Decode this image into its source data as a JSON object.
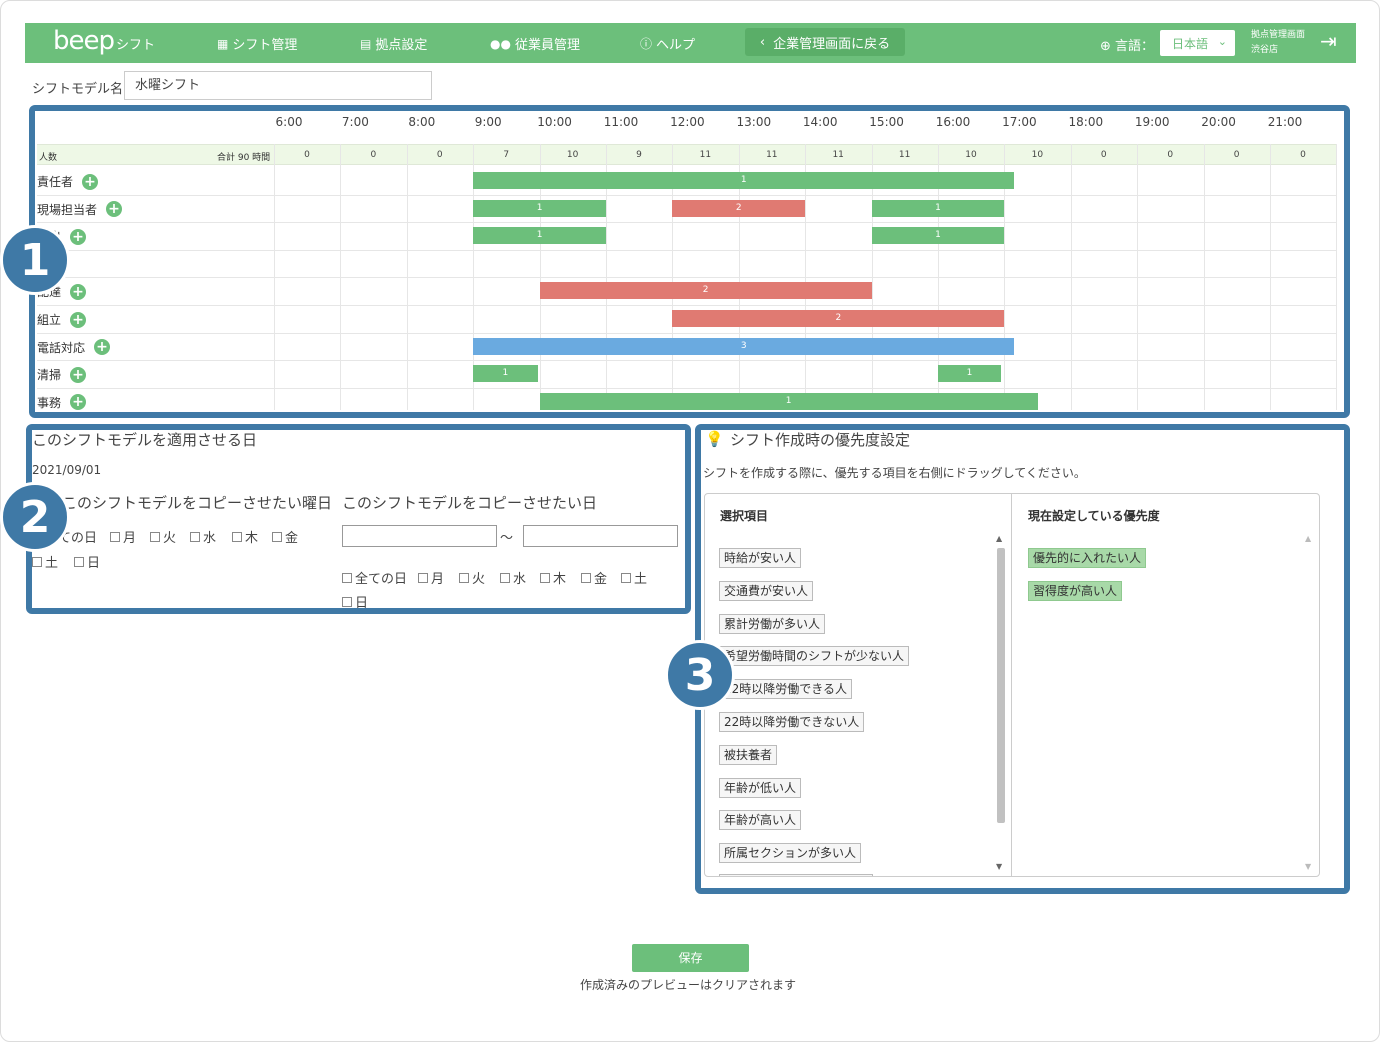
{
  "header": {
    "logo": "beep",
    "logo_sub": "シフト",
    "nav": [
      {
        "icon": "calendar-icon",
        "label": "シフト管理"
      },
      {
        "icon": "building-icon",
        "label": "拠点設定"
      },
      {
        "icon": "users-icon",
        "label": "従業員管理"
      },
      {
        "icon": "info-icon",
        "label": "ヘルプ"
      }
    ],
    "back_button": "企業管理画面に戻る",
    "language_label": "言語：",
    "language_value": "日本語",
    "store_line1": "拠点管理画面",
    "store_line2": "渋谷店"
  },
  "model": {
    "label": "シフトモデル名",
    "value": "水曜シフト"
  },
  "timeline": {
    "hours": [
      "6:00",
      "7:00",
      "8:00",
      "9:00",
      "10:00",
      "11:00",
      "12:00",
      "13:00",
      "14:00",
      "15:00",
      "16:00",
      "17:00",
      "18:00",
      "19:00",
      "20:00",
      "21:00"
    ],
    "count_label": "人数",
    "total_label": "合計 90 時間",
    "counts": [
      "0",
      "0",
      "0",
      "7",
      "10",
      "9",
      "11",
      "11",
      "11",
      "11",
      "10",
      "10",
      "0",
      "0",
      "0",
      "0"
    ],
    "rows": [
      {
        "label": "責任者",
        "bars": [
          {
            "start": 9,
            "end": 17.15,
            "count": "1",
            "color": "#6cbf7b"
          }
        ]
      },
      {
        "label": "現場担当者",
        "bars": [
          {
            "start": 9,
            "end": 11,
            "count": "1",
            "color": "#6cbf7b"
          },
          {
            "start": 12,
            "end": 14,
            "count": "2",
            "color": "#e07a72"
          },
          {
            "start": 15,
            "end": 17,
            "count": "1",
            "color": "#6cbf7b"
          }
        ]
      },
      {
        "label": "品出",
        "bars": [
          {
            "start": 9,
            "end": 11,
            "count": "1",
            "color": "#6cbf7b"
          },
          {
            "start": 15,
            "end": 17,
            "count": "1",
            "color": "#6cbf7b"
          }
        ]
      },
      {
        "label": "",
        "bars": []
      },
      {
        "label": "配達",
        "bars": [
          {
            "start": 10,
            "end": 15,
            "count": "2",
            "color": "#e07a72"
          }
        ]
      },
      {
        "label": "組立",
        "bars": [
          {
            "start": 12,
            "end": 17,
            "count": "2",
            "color": "#e07a72"
          }
        ]
      },
      {
        "label": "電話対応",
        "bars": [
          {
            "start": 9,
            "end": 17.15,
            "count": "3",
            "color": "#6aaae0"
          }
        ]
      },
      {
        "label": "清掃",
        "bars": [
          {
            "start": 9,
            "end": 9.97,
            "count": "1",
            "color": "#6cbf7b"
          },
          {
            "start": 16,
            "end": 16.95,
            "count": "1",
            "color": "#6cbf7b"
          }
        ]
      },
      {
        "label": "事務",
        "bars": [
          {
            "start": 10,
            "end": 17.5,
            "count": "1",
            "color": "#6cbf7b"
          }
        ]
      }
    ]
  },
  "apply": {
    "title": "このシフトモデルを適用させる日",
    "date": "2021/09/01",
    "weekday_title": "このシフトモデルをコピーさせたい曜日",
    "date_title": "このシフトモデルをコピーさせたい日",
    "weekdays": [
      "全ての日",
      "月",
      "火",
      "水",
      "木",
      "金",
      "土",
      "日"
    ],
    "range_sep": "～"
  },
  "priority": {
    "title": "シフト作成時の優先度設定",
    "description": "シフトを作成する際に、優先する項目を右側にドラッグしてください。",
    "left_header": "選択項目",
    "right_header": "現在設定している優先度",
    "options": [
      "時給が安い人",
      "交通費が安い人",
      "累計労働が多い人",
      "希望労働時間のシフトが少ない人",
      "22時以降労働できる人",
      "22時以降労働できない人",
      "被扶養者",
      "年齢が低い人",
      "年齢が高い人",
      "所属セクションが多い人"
    ],
    "selected": [
      "優先的に入れたい人",
      "習得度が高い人"
    ]
  },
  "badges": [
    "1",
    "2",
    "3"
  ],
  "footer": {
    "save": "保存",
    "note": "作成済みのプレビューはクリアされます"
  },
  "colors": {
    "brand": "#6cbf7b",
    "highlight": "#3f79a6",
    "bar_red": "#e07a72",
    "bar_blue": "#6aaae0"
  }
}
